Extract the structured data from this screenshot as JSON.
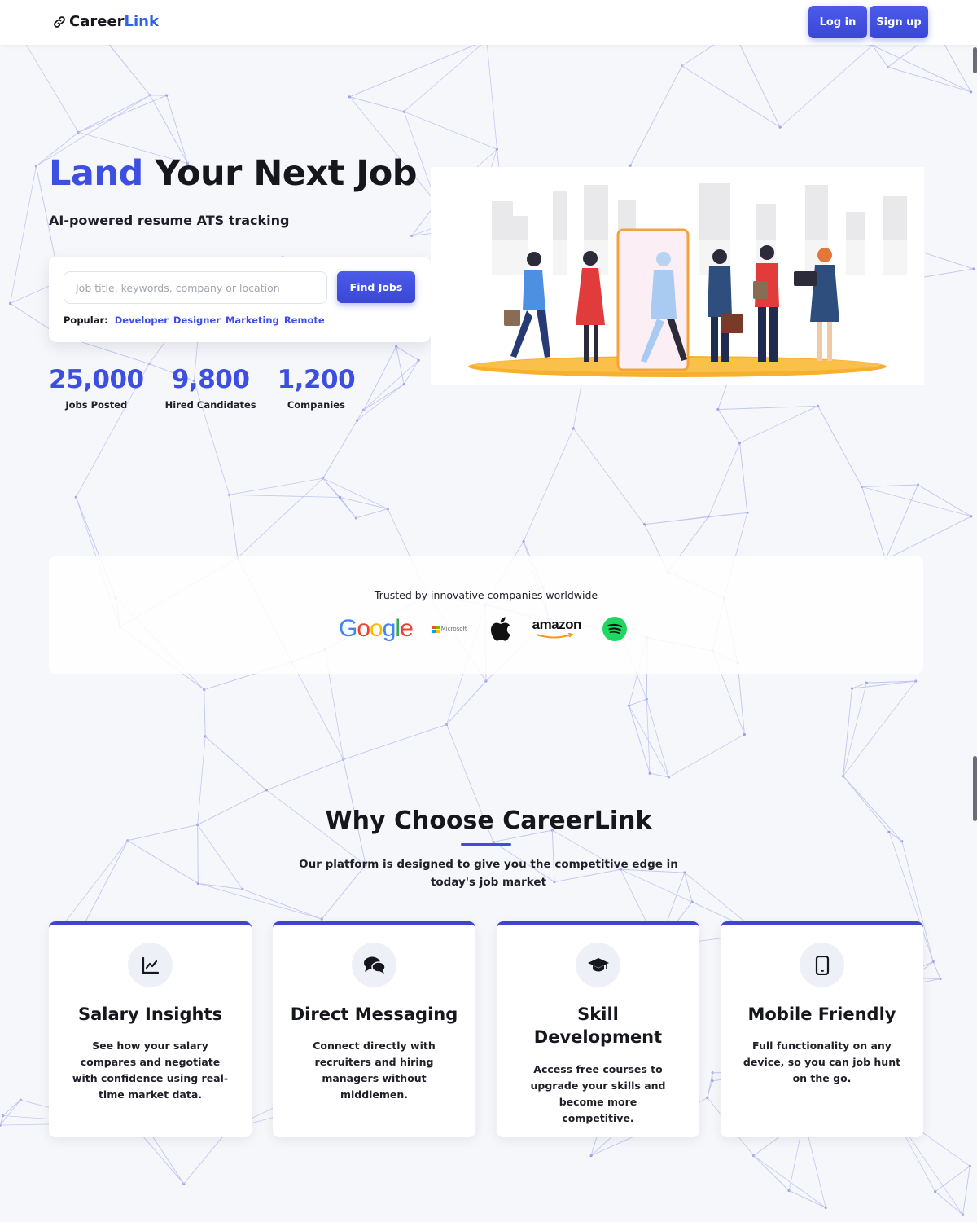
{
  "header": {
    "logo_text_1": "Career",
    "logo_text_2": "Link",
    "login_label": "Log in",
    "signup_label": "Sign up"
  },
  "hero": {
    "title_accent": "Land",
    "title_rest": "Your Next Job",
    "subtitle": "AI-powered resume ATS tracking",
    "search": {
      "placeholder": "Job title, keywords, company or location",
      "value": "",
      "button_label": "Find Jobs",
      "popular_label": "Popular:",
      "popular_tags": [
        "Developer",
        "Designer",
        "Marketing",
        "Remote"
      ]
    },
    "stats": [
      {
        "value": "25,000",
        "label": "Jobs Posted"
      },
      {
        "value": "9,800",
        "label": "Hired Candidates"
      },
      {
        "value": "1,200",
        "label": "Companies"
      }
    ]
  },
  "trusted": {
    "text": "Trusted by innovative companies worldwide",
    "logos": [
      {
        "name": "google-logo",
        "text": "Google"
      },
      {
        "name": "microsoft-logo",
        "text": "Microsoft"
      },
      {
        "name": "apple-logo",
        "text": ""
      },
      {
        "name": "amazon-logo",
        "text": "amazon"
      },
      {
        "name": "spotify-logo",
        "text": ""
      }
    ]
  },
  "why": {
    "title": "Why Choose CareerLink",
    "subtitle": "Our platform is designed to give you the competitive edge in today's job market",
    "cards": [
      {
        "icon": "chart-line-icon",
        "title": "Salary Insights",
        "desc": "See how your salary compares and negotiate with confidence using real-time market data."
      },
      {
        "icon": "chat-bubbles-icon",
        "title": "Direct Messaging",
        "desc": "Connect directly with recruiters and hiring managers without middlemen."
      },
      {
        "icon": "graduation-cap-icon",
        "title": "Skill Development",
        "desc": "Access free courses to upgrade your skills and become more competitive."
      },
      {
        "icon": "mobile-phone-icon",
        "title": "Mobile Friendly",
        "desc": "Full functionality on any device, so you can job hunt on the go."
      }
    ]
  },
  "colors": {
    "accent": "#3d4fe0",
    "brand_link": "#2f62e6",
    "background": "#f6f7fa",
    "card_border": "#3f45cc"
  }
}
